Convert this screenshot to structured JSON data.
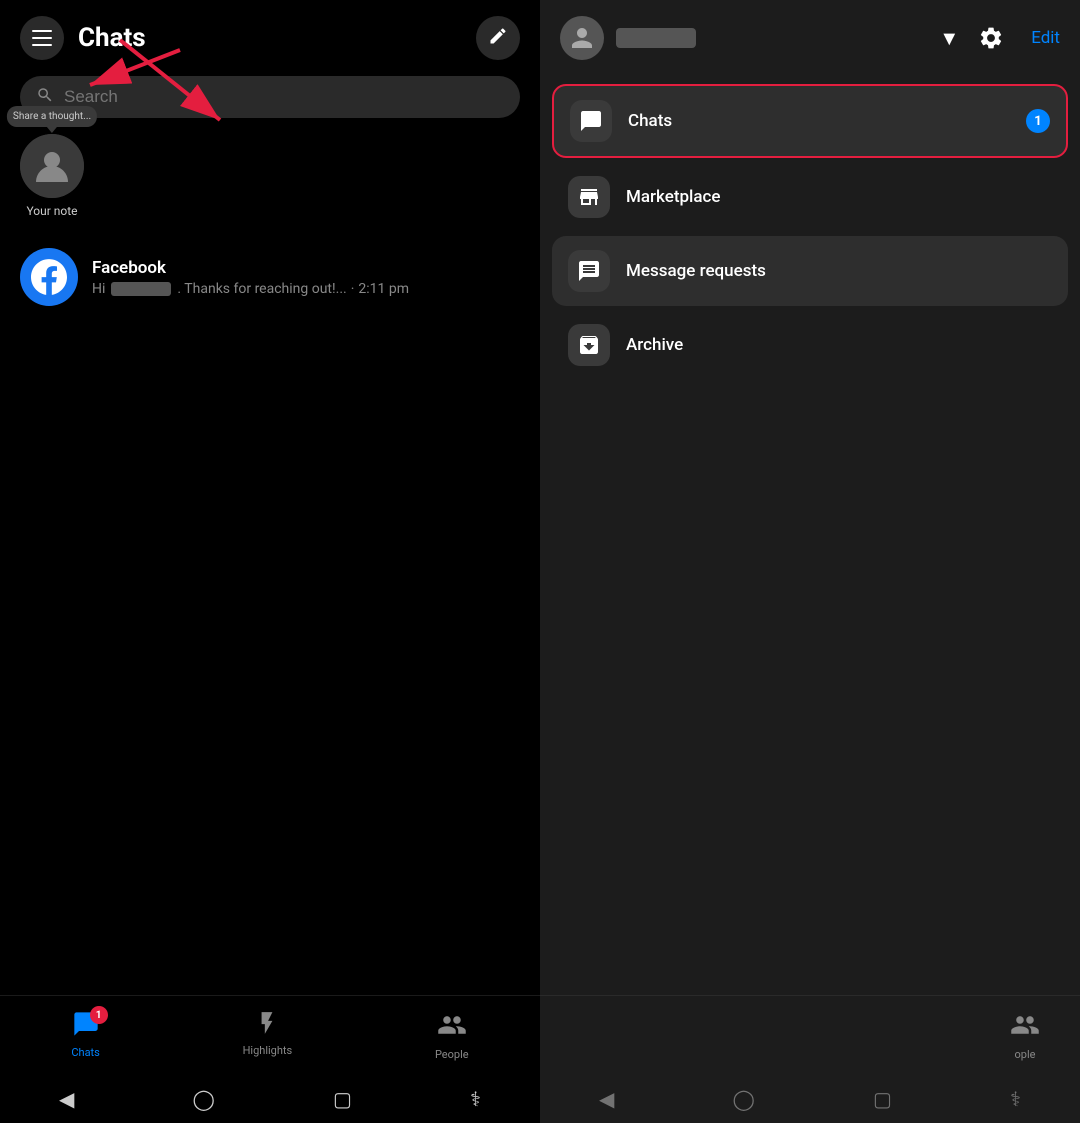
{
  "left": {
    "header_title": "Chats",
    "search_placeholder": "Search",
    "menu_btn_label": "Menu",
    "compose_btn_label": "Compose",
    "note_share_thought": "Share a thought...",
    "note_your_note": "Your note",
    "chats": [
      {
        "name": "Facebook",
        "preview_prefix": "Hi",
        "preview_suffix": ". Thanks for reaching out!...",
        "time": "2:11 pm"
      }
    ]
  },
  "right": {
    "edit_label": "Edit",
    "chevron_label": "▼",
    "menu_items": [
      {
        "id": "chats",
        "label": "Chats",
        "badge": "1",
        "active": true
      },
      {
        "id": "marketplace",
        "label": "Marketplace",
        "badge": null,
        "active": false
      },
      {
        "id": "message_requests",
        "label": "Message requests",
        "badge": null,
        "active": false,
        "highlighted": true
      },
      {
        "id": "archive",
        "label": "Archive",
        "badge": null,
        "active": false
      }
    ]
  },
  "bottom_nav": {
    "items": [
      {
        "id": "chats",
        "label": "Chats",
        "active": true,
        "badge": "1"
      },
      {
        "id": "highlights",
        "label": "Highlights",
        "active": false,
        "badge": null
      },
      {
        "id": "people",
        "label": "People",
        "active": false,
        "badge": null
      }
    ]
  },
  "colors": {
    "accent": "#0084ff",
    "badge_red": "#e41e3f",
    "dark_bg": "#000",
    "panel_bg": "#1c1c1c",
    "item_bg": "#2e2e2e"
  }
}
